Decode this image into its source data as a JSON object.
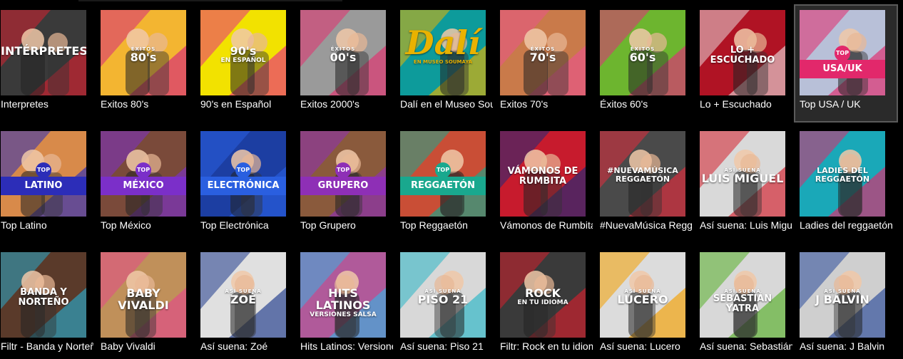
{
  "rows": [
    {
      "tiles": [
        {
          "label": "Interpretes",
          "overlay_kicker": "",
          "overlay_main": "INTÉRPRETES",
          "overlay_sub": "",
          "icon": "interpretes-thumbnail",
          "bg": "#3a3a3a",
          "accent": "#d62030"
        },
        {
          "label": "Exitos 80's",
          "overlay_kicker": "ÉXITOS",
          "overlay_main": "80's",
          "overlay_sub": "",
          "icon": "exitos-80s-thumbnail",
          "bg": "#f3b531",
          "accent": "#d6287b"
        },
        {
          "label": "90's en Español",
          "overlay_kicker": "",
          "overlay_main": "90's",
          "overlay_sub": "EN ESPAÑOL",
          "icon": "90s-espanol-thumbnail",
          "bg": "#f2e200",
          "accent": "#e82d84"
        },
        {
          "label": "Exitos 2000's",
          "overlay_kicker": "ÉXITOS",
          "overlay_main": "00's",
          "overlay_sub": "",
          "icon": "exitos-2000s-thumbnail",
          "bg": "#9a9a9a",
          "accent": "#e42f6f"
        },
        {
          "label": "Dalí en el Museo Soumaya",
          "overlay_kicker": "",
          "overlay_main": "Dalí",
          "overlay_sub": "EN MUSEO SOUMAYA",
          "icon": "dali-thumbnail",
          "bg": "#0d9b9b",
          "accent": "#e9b200"
        },
        {
          "label": "Exitos 70's",
          "overlay_kicker": "ÉXITOS",
          "overlay_main": "70's",
          "overlay_sub": "",
          "icon": "exitos-70s-thumbnail",
          "bg": "#c97a4a",
          "accent": "#e9548a"
        },
        {
          "label": "Éxitos 60's",
          "overlay_kicker": "ÉXITOS",
          "overlay_main": "60's",
          "overlay_sub": "",
          "icon": "exitos-60s-thumbnail",
          "bg": "#6db52f",
          "accent": "#e22b7b"
        },
        {
          "label": "Lo + Escuchado",
          "overlay_kicker": "",
          "overlay_main": "LO + ESCUCHADO",
          "overlay_sub": "",
          "icon": "lo-mas-escuchado-thumbnail",
          "bg": "#b01324",
          "accent": "#e8d7d9"
        },
        {
          "label": "Top USA / UK",
          "overlay_kicker": "TOP",
          "overlay_main": "USA/UK",
          "overlay_sub": "",
          "icon": "top-usa-uk-thumbnail",
          "bg": "#b8c0d8",
          "accent": "#e2286b",
          "selected": true
        }
      ]
    },
    {
      "tiles": [
        {
          "label": "Top Latino",
          "overlay_kicker": "TOP",
          "overlay_main": "LATINO",
          "overlay_sub": "",
          "icon": "top-latino-thumbnail",
          "bg": "#d88a4a",
          "accent": "#2c2db8"
        },
        {
          "label": "Top México",
          "overlay_kicker": "TOP",
          "overlay_main": "MÉXICO",
          "overlay_sub": "",
          "icon": "top-mexico-thumbnail",
          "bg": "#7a4a3a",
          "accent": "#7b2fc9"
        },
        {
          "label": "Top Electrónica",
          "overlay_kicker": "TOP",
          "overlay_main": "ELECTRÓNICA",
          "overlay_sub": "",
          "icon": "top-electronica-thumbnail",
          "bg": "#1c3ea2",
          "accent": "#2a5fe0"
        },
        {
          "label": "Top Grupero",
          "overlay_kicker": "TOP",
          "overlay_main": "GRUPERO",
          "overlay_sub": "",
          "icon": "top-grupero-thumbnail",
          "bg": "#8a5a3c",
          "accent": "#8e2fb6"
        },
        {
          "label": "Top Reggaetón",
          "overlay_kicker": "TOP",
          "overlay_main": "REGGAETÓN",
          "overlay_sub": "",
          "icon": "top-reggaeton-thumbnail",
          "bg": "#c94e36",
          "accent": "#19a88e"
        },
        {
          "label": "Vámonos de Rumbita",
          "overlay_kicker": "",
          "overlay_main": "VÁMONOS DE RUMBITA",
          "overlay_sub": "",
          "icon": "vamonos-de-rumbita-thumbnail",
          "bg": "#c71b2d",
          "accent": "#1f2a7a"
        },
        {
          "label": "#NuevaMúsica Reggaetón",
          "overlay_kicker": "",
          "overlay_main": "#NUEVAMÚSICA REGGAETÓN",
          "overlay_sub": "",
          "icon": "nueva-musica-reggaeton-thumbnail",
          "bg": "#4a4a4a",
          "accent": "#e22b3c"
        },
        {
          "label": "Así suena: Luis Miguel",
          "overlay_kicker": "ASÍ SUENA",
          "overlay_main": "LUIS MIGUEL",
          "overlay_sub": "",
          "icon": "asi-suena-luis-miguel-thumbnail",
          "bg": "#d9d9d9",
          "accent": "#d41f2c"
        },
        {
          "label": "Ladies del reggaetón",
          "overlay_kicker": "",
          "overlay_main": "LADIES DEL REGGAETÓN",
          "overlay_sub": "",
          "icon": "ladies-del-reggaeton-thumbnail",
          "bg": "#1aa8b8",
          "accent": "#e2286b"
        }
      ]
    },
    {
      "tiles": [
        {
          "label": "Filtr - Banda y Norteño",
          "overlay_kicker": "",
          "overlay_main": "BANDA Y NORTEÑO",
          "overlay_sub": "",
          "icon": "banda-y-norteno-thumbnail",
          "bg": "#5a3a2a",
          "accent": "#2aa8c9"
        },
        {
          "label": "Baby Vivaldi",
          "overlay_kicker": "",
          "overlay_main": "BABY VIVALDI",
          "overlay_sub": "",
          "icon": "baby-vivaldi-thumbnail",
          "bg": "#c0905a",
          "accent": "#e24a8a"
        },
        {
          "label": "Así suena: Zoé",
          "overlay_kicker": "ASÍ SUENA",
          "overlay_main": "ZOÉ",
          "overlay_sub": "",
          "icon": "asi-suena-zoe-thumbnail",
          "bg": "#e0e0e0",
          "accent": "#1f3a8c"
        },
        {
          "label": "Hits Latinos: Versiones Salsa",
          "overlay_kicker": "",
          "overlay_main": "HITS LATINOS",
          "overlay_sub": "VERSIONES SALSA",
          "icon": "hits-latinos-salsa-thumbnail",
          "bg": "#b05a9a",
          "accent": "#3ab0e0"
        },
        {
          "label": "Así suena: Piso 21",
          "overlay_kicker": "ASÍ SUENA",
          "overlay_main": "PISO 21",
          "overlay_sub": "",
          "icon": "asi-suena-piso21-thumbnail",
          "bg": "#d8d8d8",
          "accent": "#2ab7c7"
        },
        {
          "label": "Filtr: Rock en tu idioma",
          "overlay_kicker": "",
          "overlay_main": "ROCK",
          "overlay_sub": "EN TU IDIOMA",
          "icon": "rock-en-tu-idioma-thumbnail",
          "bg": "#3a3a3a",
          "accent": "#d41f2c"
        },
        {
          "label": "Así suena: Lucero",
          "overlay_kicker": "ASÍ SUENA",
          "overlay_main": "LUCERO",
          "overlay_sub": "",
          "icon": "asi-suena-lucero-thumbnail",
          "bg": "#dcdcdc",
          "accent": "#f4a000"
        },
        {
          "label": "Así suena: Sebastián Yatra",
          "overlay_kicker": "ASÍ SUENA",
          "overlay_main": "SEBASTIÁN YATRA",
          "overlay_sub": "",
          "icon": "asi-suena-sebastian-yatra-thumbnail",
          "bg": "#d8d8d8",
          "accent": "#58b02a"
        },
        {
          "label": "Así suena: J Balvin",
          "overlay_kicker": "ASÍ SUENA",
          "overlay_main": "J BALVIN",
          "overlay_sub": "",
          "icon": "asi-suena-j-balvin-thumbnail",
          "bg": "#cfcfcf",
          "accent": "#2a4a9a"
        }
      ]
    }
  ]
}
